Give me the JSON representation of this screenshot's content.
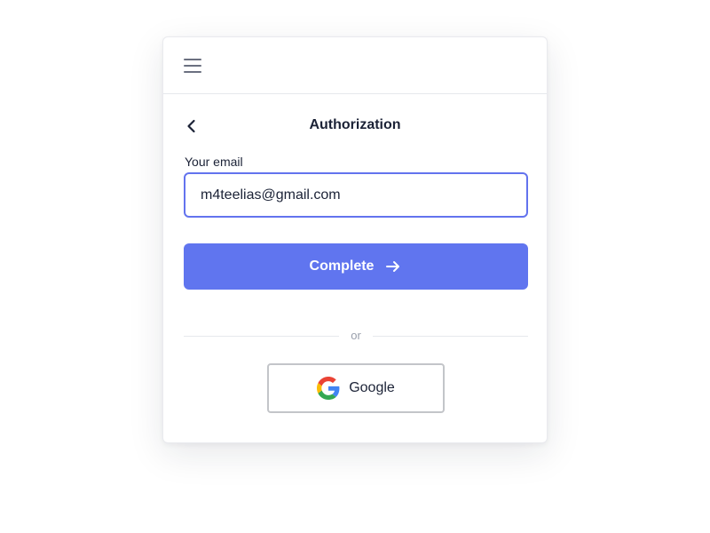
{
  "header": {
    "menu_icon": "hamburger-menu-icon",
    "back_icon": "chevron-left-icon",
    "title": "Authorization"
  },
  "form": {
    "email_label": "Your email",
    "email_value": "m4teelias@gmail.com",
    "submit_label": "Complete",
    "submit_icon": "arrow-right-icon"
  },
  "alt_login": {
    "divider_text": "or",
    "google_label": "Google",
    "google_icon": "google-logo-icon"
  },
  "colors": {
    "accent": "#6075ef",
    "input_border": "#6373ee",
    "text": "#1b2236",
    "muted": "#9aa0ac"
  }
}
